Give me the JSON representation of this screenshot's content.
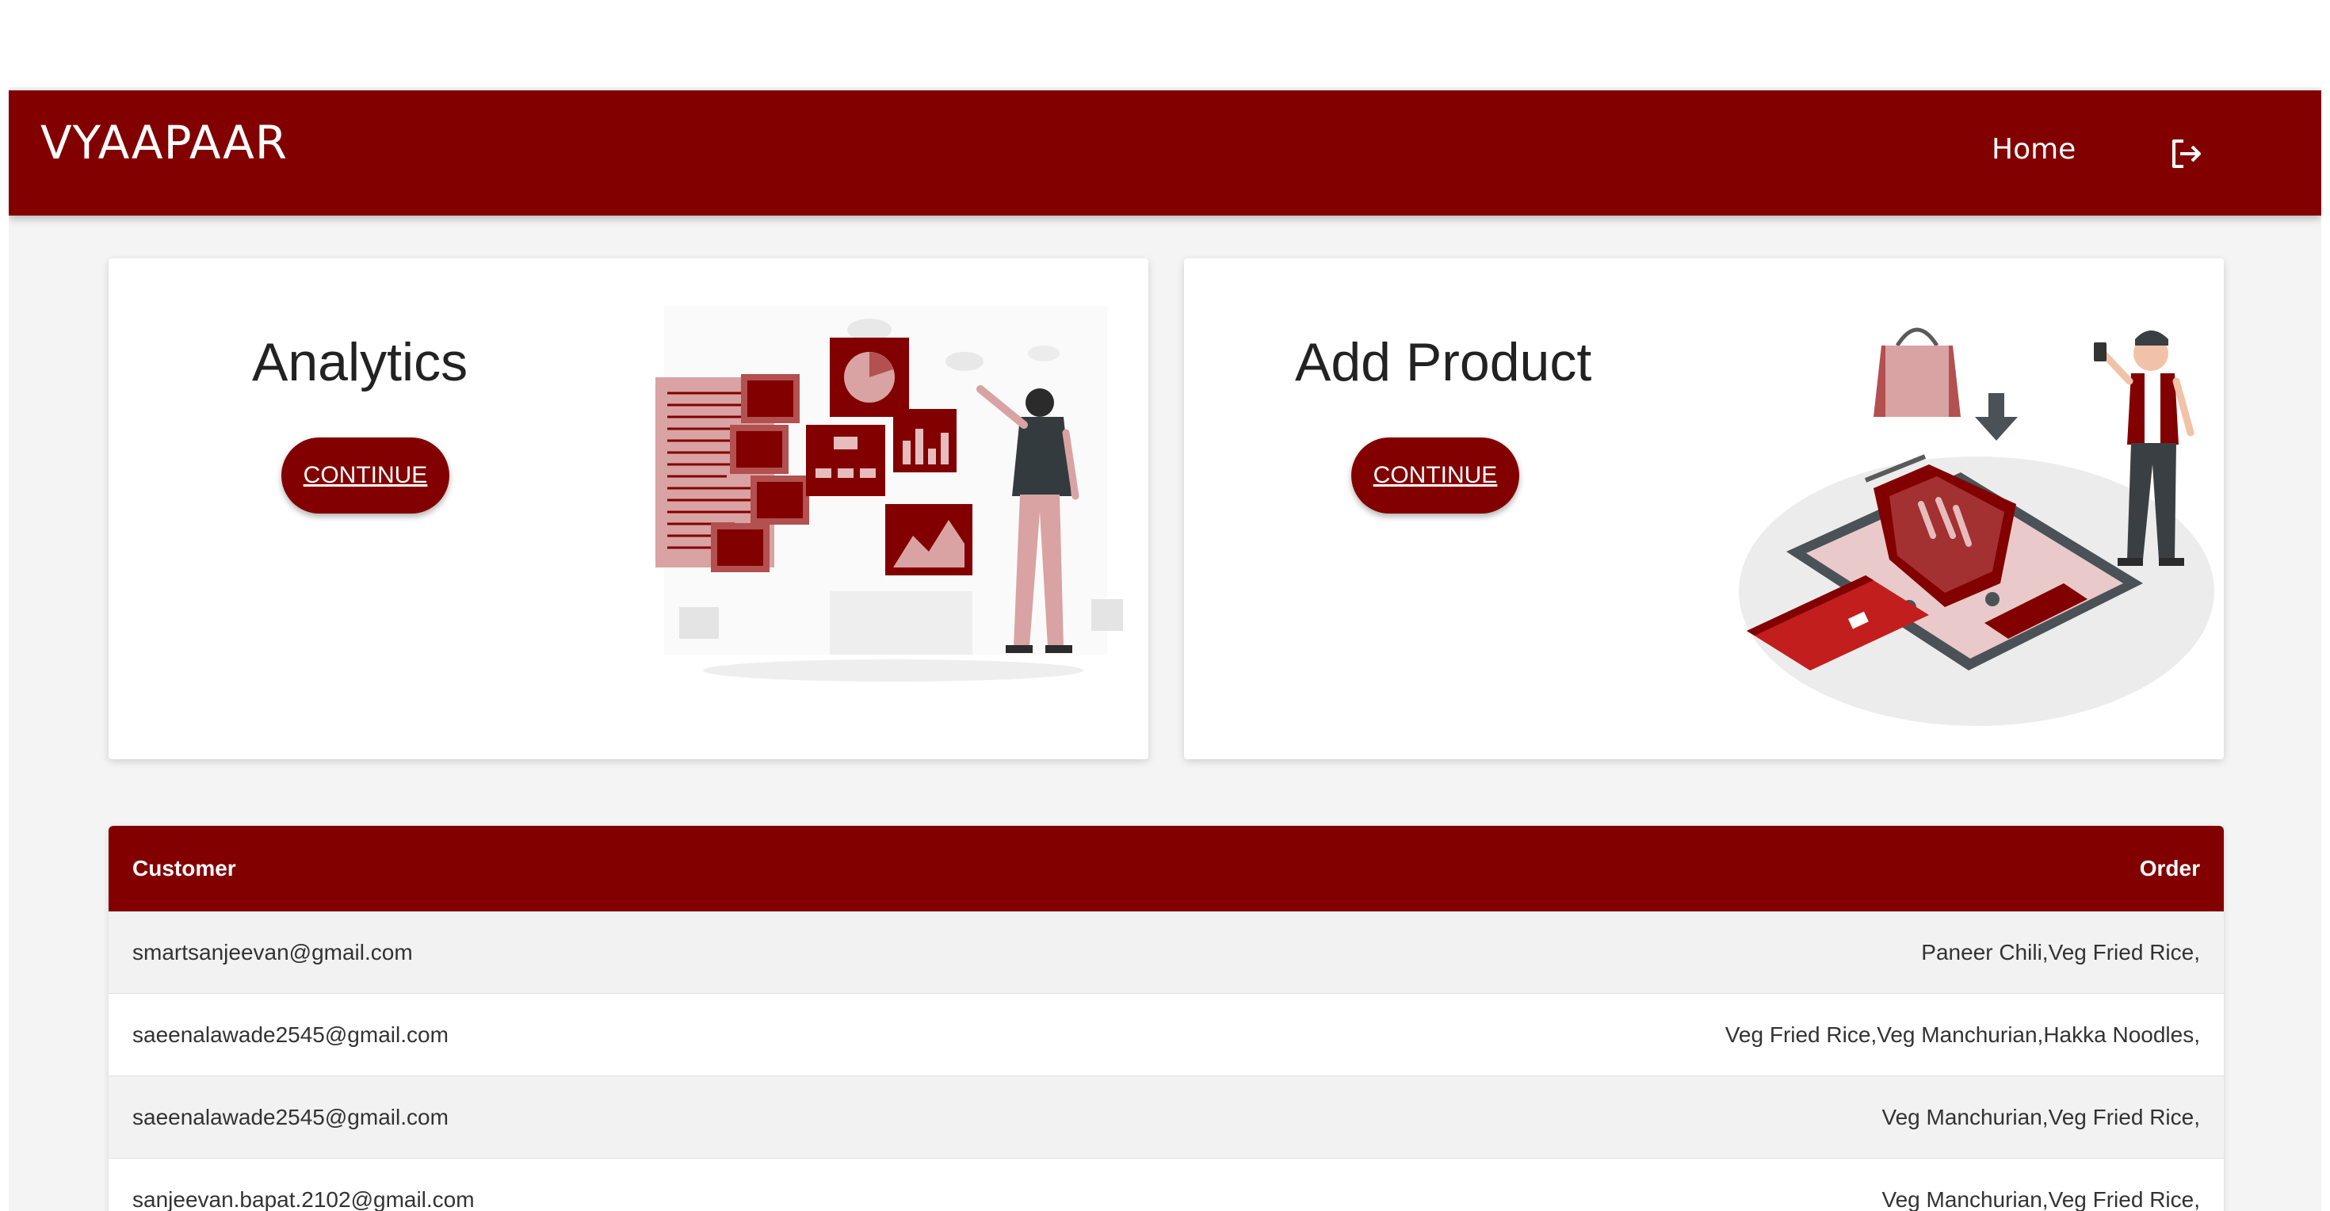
{
  "app": {
    "brand": "VYAAPAAR"
  },
  "nav": {
    "home_label": "Home",
    "logout_icon": "logout-icon"
  },
  "cards": [
    {
      "title": "Analytics",
      "button_label": "CONTINUE",
      "illustration": "analytics-illustration"
    },
    {
      "title": "Add Product",
      "button_label": "CONTINUE",
      "illustration": "shopping-cart-illustration"
    }
  ],
  "table": {
    "headers": {
      "customer": "Customer",
      "order": "Order"
    },
    "rows": [
      {
        "customer": "smartsanjeevan@gmail.com",
        "order": "Paneer Chili,Veg Fried Rice,"
      },
      {
        "customer": "saeenalawade2545@gmail.com",
        "order": "Veg Fried Rice,Veg Manchurian,Hakka Noodles,"
      },
      {
        "customer": "saeenalawade2545@gmail.com",
        "order": "Veg Manchurian,Veg Fried Rice,"
      },
      {
        "customer": "sanjeevan.bapat.2102@gmail.com",
        "order": "Veg Manchurian,Veg Fried Rice,"
      }
    ]
  },
  "colors": {
    "primary": "#820000",
    "background": "#f4f4f4",
    "row_alt": "#f2f2f2"
  }
}
